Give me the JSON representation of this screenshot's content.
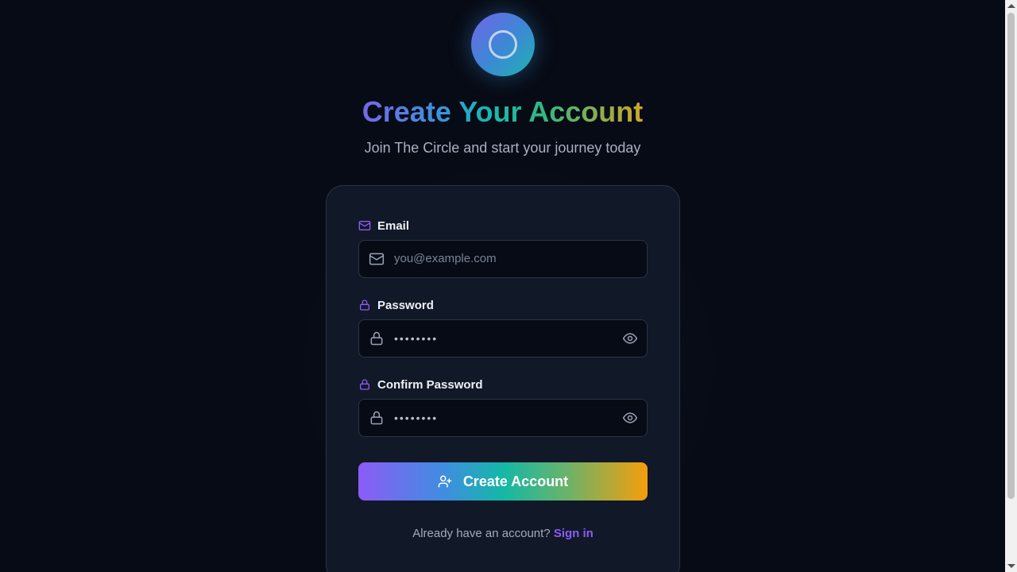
{
  "header": {
    "title": "Create Your Account",
    "subtitle": "Join The Circle and start your journey today"
  },
  "form": {
    "email": {
      "label": "Email",
      "placeholder": "you@example.com",
      "value": ""
    },
    "password": {
      "label": "Password",
      "masked_value": "••••••••"
    },
    "confirm_password": {
      "label": "Confirm Password",
      "masked_value": "••••••••"
    },
    "submit_label": "Create Account"
  },
  "footer": {
    "prompt": "Already have an account? ",
    "link_label": "Sign in"
  },
  "icons": {
    "logo": "circle-logo-icon",
    "email": "mail-icon",
    "password": "lock-icon",
    "reveal": "eye-icon",
    "submit": "user-plus-icon"
  },
  "colors": {
    "background": "#070b15",
    "card": "#111827",
    "accent_purple": "#8b5cf6",
    "accent_teal": "#14b8a6",
    "accent_amber": "#f59e0b"
  }
}
